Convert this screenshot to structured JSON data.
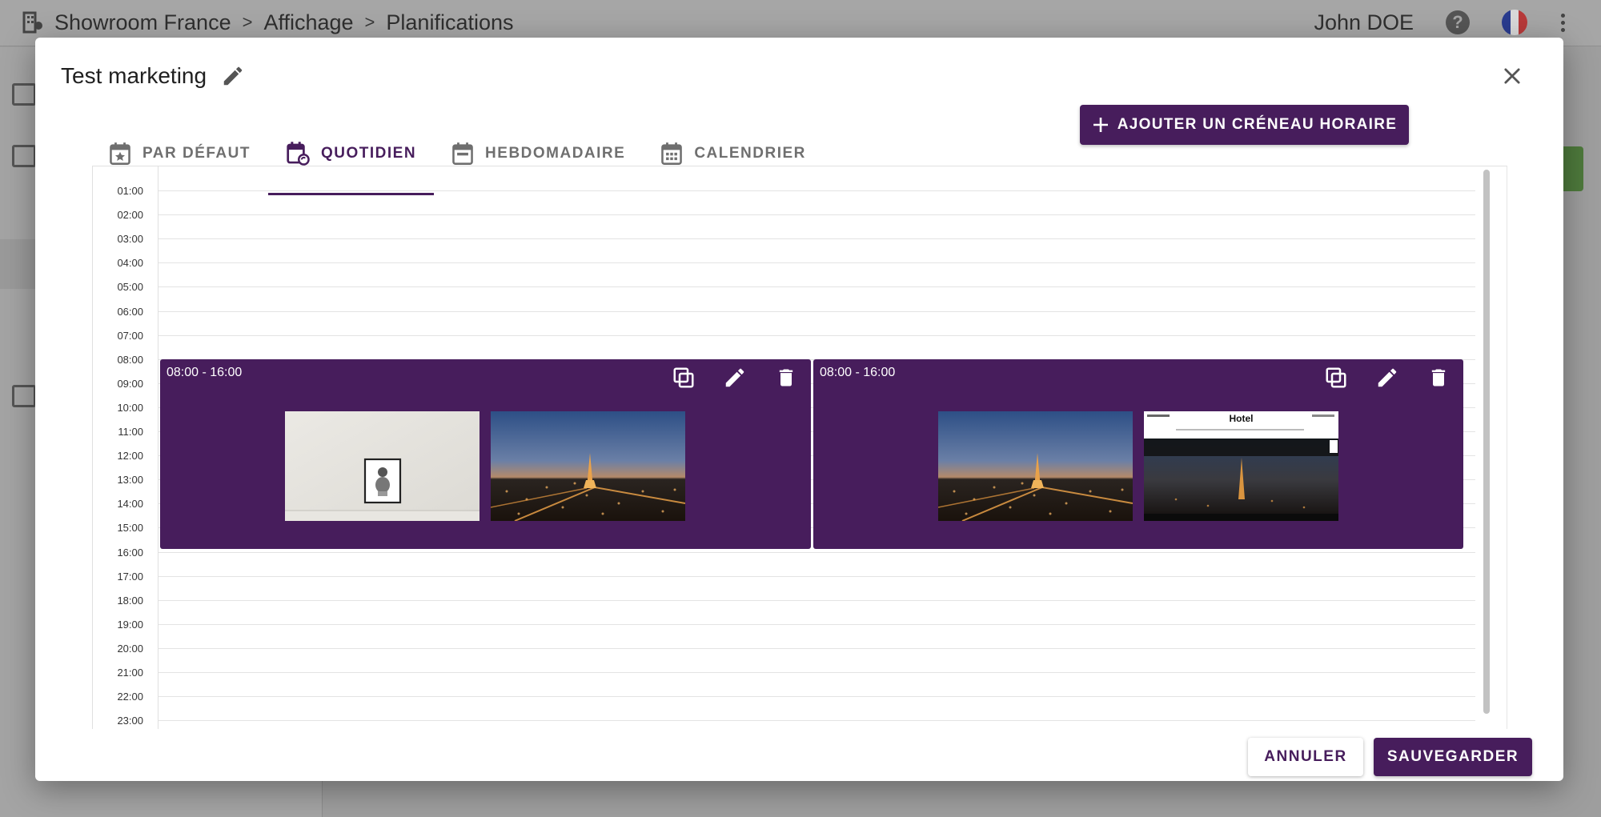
{
  "breadcrumb": {
    "items": [
      "Showroom France",
      "Affichage",
      "Planifications"
    ],
    "separator": ">"
  },
  "header": {
    "user_name": "John DOE",
    "help_icon": "help-circle-icon",
    "language_icon": "flag-fr-icon"
  },
  "dialog": {
    "title": "Test marketing",
    "tabs": [
      {
        "label": "PAR DÉFAUT",
        "icon": "calendar-star-icon",
        "active": false
      },
      {
        "label": "QUOTIDIEN",
        "icon": "calendar-sync-icon",
        "active": true
      },
      {
        "label": "HEBDOMADAIRE",
        "icon": "calendar-week-icon",
        "active": false
      },
      {
        "label": "CALENDRIER",
        "icon": "calendar-month-icon",
        "active": false
      }
    ],
    "add_button": "AJOUTER UN CRÉNEAU HORAIRE",
    "hours": [
      "01:00",
      "02:00",
      "03:00",
      "04:00",
      "05:00",
      "06:00",
      "07:00",
      "08:00",
      "09:00",
      "10:00",
      "11:00",
      "12:00",
      "13:00",
      "14:00",
      "15:00",
      "16:00",
      "17:00",
      "18:00",
      "19:00",
      "20:00",
      "21:00",
      "22:00",
      "23:00"
    ],
    "slots": [
      {
        "time": "08:00 - 16:00",
        "media": [
          "framed-picture-on-wall",
          "paris-eiffel-tower-night"
        ]
      },
      {
        "time": "08:00 - 16:00",
        "media": [
          "paris-eiffel-tower-night",
          "hotel-welcome-screen"
        ]
      }
    ],
    "hotel_screen_title": "Hotel",
    "cancel_button": "ANNULER",
    "save_button": "SAUVEGARDER"
  },
  "colors": {
    "primary": "#471d5c",
    "overlay": "#9e9e9e",
    "accent_green": "#4e7a3c"
  }
}
